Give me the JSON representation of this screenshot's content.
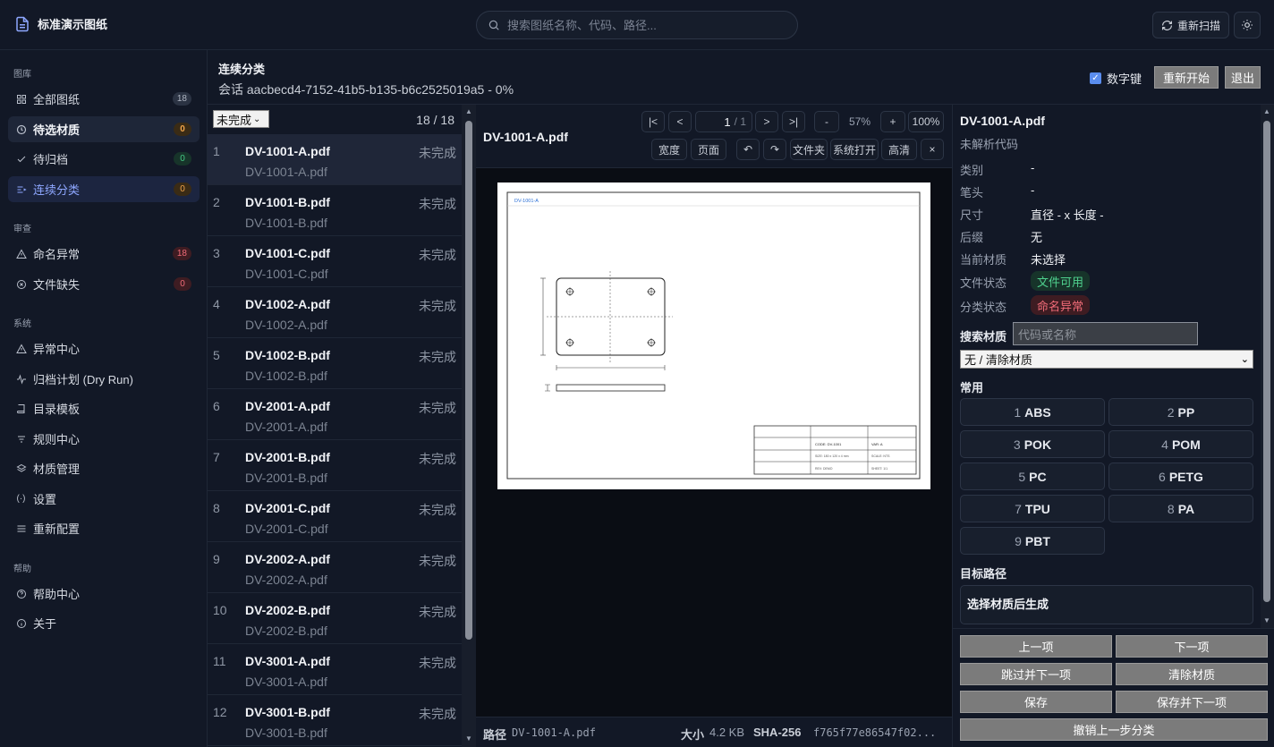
{
  "app": {
    "title": "标准演示图纸"
  },
  "search": {
    "placeholder": "搜索图纸名称、代码、路径..."
  },
  "header": {
    "rescan_label": "重新扫描"
  },
  "sidebar": {
    "sections": [
      "图库",
      "审查",
      "系统",
      "帮助"
    ],
    "library": [
      {
        "label": "全部图纸",
        "icon": "grid-icon",
        "badge": "18",
        "badge_color": "gray"
      },
      {
        "label": "待选材质",
        "icon": "clock-icon",
        "badge": "0",
        "badge_color": "orange"
      },
      {
        "label": "待归档",
        "icon": "check-icon",
        "badge": "0",
        "badge_color": "green"
      },
      {
        "label": "连续分类",
        "icon": "list-icon",
        "badge": "0",
        "badge_color": "orange"
      }
    ],
    "review": [
      {
        "label": "命名异常",
        "icon": "warning-icon",
        "badge": "18",
        "badge_color": "red"
      },
      {
        "label": "文件缺失",
        "icon": "x-circle-icon",
        "badge": "0",
        "badge_color": "red"
      }
    ],
    "system": [
      {
        "label": "异常中心",
        "icon": "warning-icon"
      },
      {
        "label": "归档计划 (Dry Run)",
        "icon": "activity-icon"
      },
      {
        "label": "目录模板",
        "icon": "book-icon"
      },
      {
        "label": "规则中心",
        "icon": "filter-icon"
      },
      {
        "label": "材质管理",
        "icon": "layers-icon"
      },
      {
        "label": "设置",
        "icon": "settings-icon"
      },
      {
        "label": "重新配置",
        "icon": "menu-icon"
      }
    ],
    "help": [
      {
        "label": "帮助中心",
        "icon": "help-icon"
      },
      {
        "label": "关于",
        "icon": "info-icon"
      }
    ]
  },
  "session": {
    "title": "连续分类",
    "subtitle": "会话 aacbecd4-7152-41b5-b135-b6c2525019a5 - 0%",
    "numkey_label": "数字键",
    "restart_label": "重新开始",
    "exit_label": "退出"
  },
  "list": {
    "filter_value": "未完成",
    "count": "18 / 18",
    "items": [
      {
        "idx": "1",
        "name": "DV-1001-A.pdf",
        "sub": "DV-1001-A.pdf",
        "status": "未完成"
      },
      {
        "idx": "2",
        "name": "DV-1001-B.pdf",
        "sub": "DV-1001-B.pdf",
        "status": "未完成"
      },
      {
        "idx": "3",
        "name": "DV-1001-C.pdf",
        "sub": "DV-1001-C.pdf",
        "status": "未完成"
      },
      {
        "idx": "4",
        "name": "DV-1002-A.pdf",
        "sub": "DV-1002-A.pdf",
        "status": "未完成"
      },
      {
        "idx": "5",
        "name": "DV-1002-B.pdf",
        "sub": "DV-1002-B.pdf",
        "status": "未完成"
      },
      {
        "idx": "6",
        "name": "DV-2001-A.pdf",
        "sub": "DV-2001-A.pdf",
        "status": "未完成"
      },
      {
        "idx": "7",
        "name": "DV-2001-B.pdf",
        "sub": "DV-2001-B.pdf",
        "status": "未完成"
      },
      {
        "idx": "8",
        "name": "DV-2001-C.pdf",
        "sub": "DV-2001-C.pdf",
        "status": "未完成"
      },
      {
        "idx": "9",
        "name": "DV-2002-A.pdf",
        "sub": "DV-2002-A.pdf",
        "status": "未完成"
      },
      {
        "idx": "10",
        "name": "DV-2002-B.pdf",
        "sub": "DV-2002-B.pdf",
        "status": "未完成"
      },
      {
        "idx": "11",
        "name": "DV-3001-A.pdf",
        "sub": "DV-3001-A.pdf",
        "status": "未完成"
      },
      {
        "idx": "12",
        "name": "DV-3001-B.pdf",
        "sub": "DV-3001-B.pdf",
        "status": "未完成"
      }
    ]
  },
  "viewer": {
    "filename": "DV-1001-A.pdf",
    "toolbar": {
      "first": "|<",
      "prev": "<",
      "page_current": "1",
      "page_total": "/ 1",
      "next": ">",
      "last": ">|",
      "zoom_out": "-",
      "zoom_level": "57%",
      "zoom_in": "+",
      "zoom_reset": "100%",
      "fit_width": "宽度",
      "fit_page": "页面",
      "rotate_left": "↶",
      "rotate_right": "↷",
      "open_folder": "文件夹",
      "open_system": "系统打开",
      "hd": "高清",
      "close": "×"
    },
    "drawing": {
      "header_text": "DV-1001-A",
      "code": "CODE: DV-1001",
      "var": "VAR: A",
      "size": "SIZE: 180 x 120 x 4 mm",
      "scale": "SCALE: NTS",
      "rev": "REV: DEMO",
      "sheet": "SHEET: 1/1"
    },
    "footer": {
      "path_label": "路径",
      "path_value": "DV-1001-A.pdf",
      "size_label": "大小",
      "size_value": "4.2 KB",
      "sha_label": "SHA-256",
      "sha_value": "f765f77e86547f02..."
    }
  },
  "detail": {
    "filename": "DV-1001-A.pdf",
    "code_status": "未解析代码",
    "fields": [
      {
        "key": "类别",
        "value": "-"
      },
      {
        "key": "笔头",
        "value": "-"
      },
      {
        "key": "尺寸",
        "value": "直径 - x 长度 -"
      },
      {
        "key": "后缀",
        "value": "无"
      },
      {
        "key": "当前材质",
        "value": "未选择"
      }
    ],
    "file_status_label": "文件状态",
    "file_status_value": "文件可用",
    "class_status_label": "分类状态",
    "class_status_value": "命名异常",
    "search_label": "搜索材质",
    "search_placeholder": "代码或名称",
    "material_select": "无 / 清除材质",
    "common_label": "常用",
    "materials": [
      {
        "key": "1",
        "name": "ABS"
      },
      {
        "key": "2",
        "name": "PP"
      },
      {
        "key": "3",
        "name": "POK"
      },
      {
        "key": "4",
        "name": "POM"
      },
      {
        "key": "5",
        "name": "PC"
      },
      {
        "key": "6",
        "name": "PETG"
      },
      {
        "key": "7",
        "name": "TPU"
      },
      {
        "key": "8",
        "name": "PA"
      },
      {
        "key": "9",
        "name": "PBT"
      }
    ],
    "target_label": "目标路径",
    "target_value": "选择材质后生成"
  },
  "actions": {
    "prev": "上一项",
    "next": "下一项",
    "skip": "跳过并下一项",
    "clear": "清除材质",
    "save": "保存",
    "save_next": "保存并下一项",
    "undo": "撤销上一步分类"
  },
  "colors": {
    "accent": "#8ea7ff",
    "background": "#0b0f17",
    "panel": "#121826",
    "ok_green": "#4fd18e",
    "error_red": "#f06b78",
    "warning_orange": "#f0a44b"
  }
}
